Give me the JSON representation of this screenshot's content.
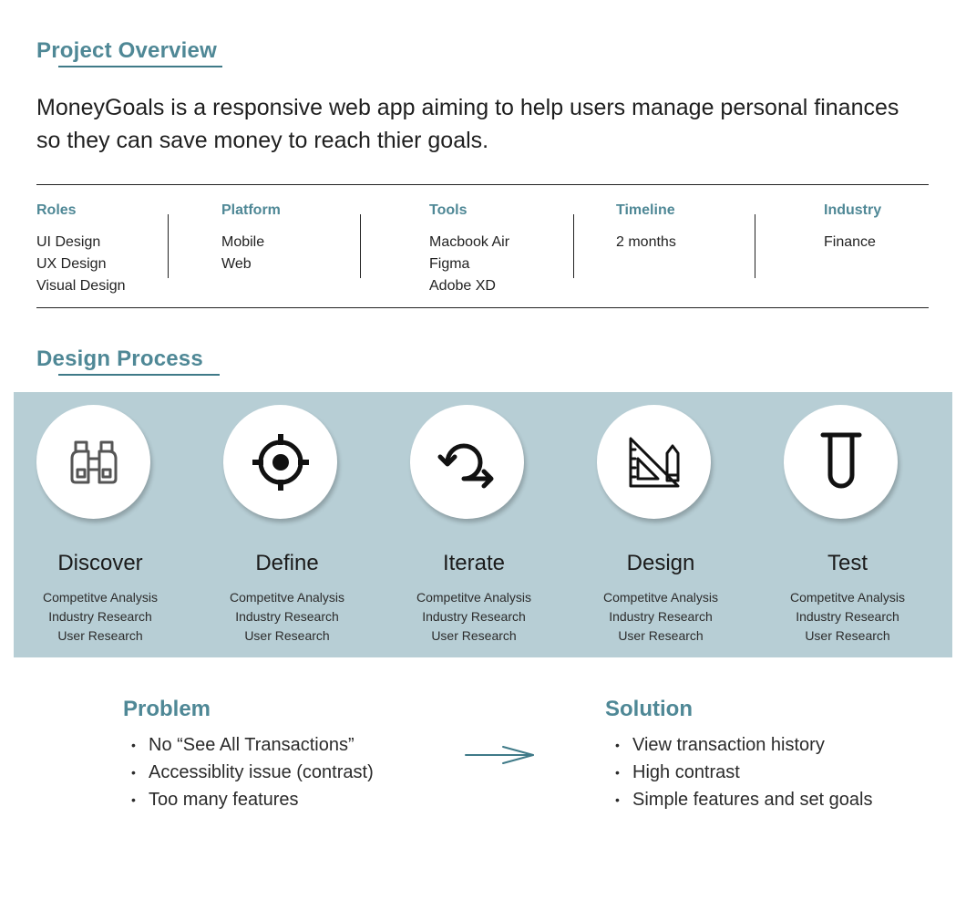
{
  "overview": {
    "title": "Project Overview",
    "description": "MoneyGoals is a responsive web app aiming to help users manage personal finances so they can save money to reach thier goals."
  },
  "details": [
    {
      "heading": "Roles",
      "values": [
        "UI Design",
        "UX Design",
        "Visual Design"
      ]
    },
    {
      "heading": "Platform",
      "values": [
        "Mobile",
        "Web"
      ]
    },
    {
      "heading": "Tools",
      "values": [
        "Macbook Air",
        "Figma",
        "Adobe XD"
      ]
    },
    {
      "heading": "Timeline",
      "values": [
        "2 months"
      ]
    },
    {
      "heading": "Industry",
      "values": [
        "Finance"
      ]
    }
  ],
  "process": {
    "title": "Design Process",
    "steps": [
      {
        "name": "Discover",
        "icon": "binoculars-icon",
        "items": [
          "Competitve Analysis",
          "Industry Research",
          "User Research"
        ]
      },
      {
        "name": "Define",
        "icon": "target-icon",
        "items": [
          "Competitve Analysis",
          "Industry Research",
          "User Research"
        ]
      },
      {
        "name": "Iterate",
        "icon": "iterate-arrow-icon",
        "items": [
          "Competitve Analysis",
          "Industry Research",
          "User Research"
        ]
      },
      {
        "name": "Design",
        "icon": "ruler-pencil-icon",
        "items": [
          "Competitve Analysis",
          "Industry Research",
          "User Research"
        ]
      },
      {
        "name": "Test",
        "icon": "test-tube-icon",
        "items": [
          "Competitve Analysis",
          "Industry Research",
          "User Research"
        ]
      }
    ]
  },
  "problem": {
    "title": "Problem",
    "items": [
      "No “See All Transactions”",
      "Accessiblity issue (contrast)",
      "Too many features"
    ]
  },
  "solution": {
    "title": "Solution",
    "items": [
      "View transaction history",
      "High contrast",
      "Simple features and set goals"
    ]
  },
  "colors": {
    "accent": "#4f8896",
    "band": "#b7ced5"
  }
}
